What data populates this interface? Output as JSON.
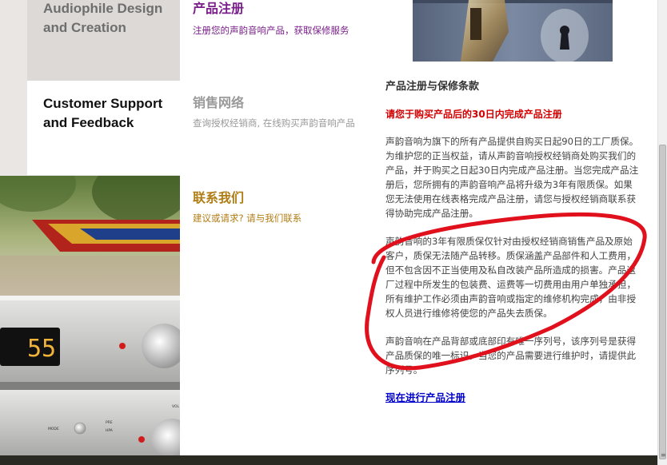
{
  "left_nav": {
    "item1_line1": "Audiophile Design",
    "item1_line2": "and Creation",
    "item2_line1": "Customer Support",
    "item2_line2": "and Feedback"
  },
  "photo": {
    "display_value": "55",
    "mode_label": "MODE",
    "pre_label": "PRE",
    "hpa_label": "HPA",
    "vol_label": "VOL"
  },
  "sections": [
    {
      "title": "产品注册",
      "subtitle": "注册您的声韵音响产品，获取保修服务",
      "title_color": "#7a1f8a",
      "subtitle_color": "#7a1f8a"
    },
    {
      "title": "销售网络",
      "subtitle": "查询授权经销商, 在线购买声韵音响产品",
      "title_color": "#9a9a9a",
      "subtitle_color": "#9a9a9a"
    },
    {
      "title": "联系我们",
      "subtitle": "建议或请求? 请与我们联系",
      "title_color": "#b07c14",
      "subtitle_color": "#b07c14"
    }
  ],
  "warranty": {
    "heading": "产品注册与保修条款",
    "notice": "请您于购买产品后的30日内完成产品注册",
    "para1": "声韵音响为旗下的所有产品提供自购买日起90日的工厂质保。为维护您的正当权益，请从声韵音响授权经销商处购买我们的产品，并于购买之日起30日内完成产品注册。当您完成产品注册后，您所拥有的声韵音响产品将升级为3年有限质保。如果您无法使用在线表格完成产品注册，请您与授权经销商联系获得协助完成产品注册。",
    "para2": "声韵音响的3年有限质保仅针对由授权经销商销售产品及原始客户，质保无法随产品转移。质保涵盖产品部件和人工费用，但不包含因不正当使用及私自改装产品所造成的损害。产品返厂过程中所发生的包装费、运费等一切费用由用户单独承担，所有维护工作必须由声韵音响或指定的维修机构完成，由非授权人员进行维修将使您的产品失去质保。",
    "para3": "声韵音响在产品背部或底部印有唯一序列号，该序列号是获得产品质保的唯一标识。当您的产品需要进行维护时，请提供此序列号。",
    "link": "现在进行产品注册"
  },
  "colors": {
    "notice_red": "#d40000",
    "link_blue": "#0000cc",
    "annotation_red": "#e0101c"
  }
}
